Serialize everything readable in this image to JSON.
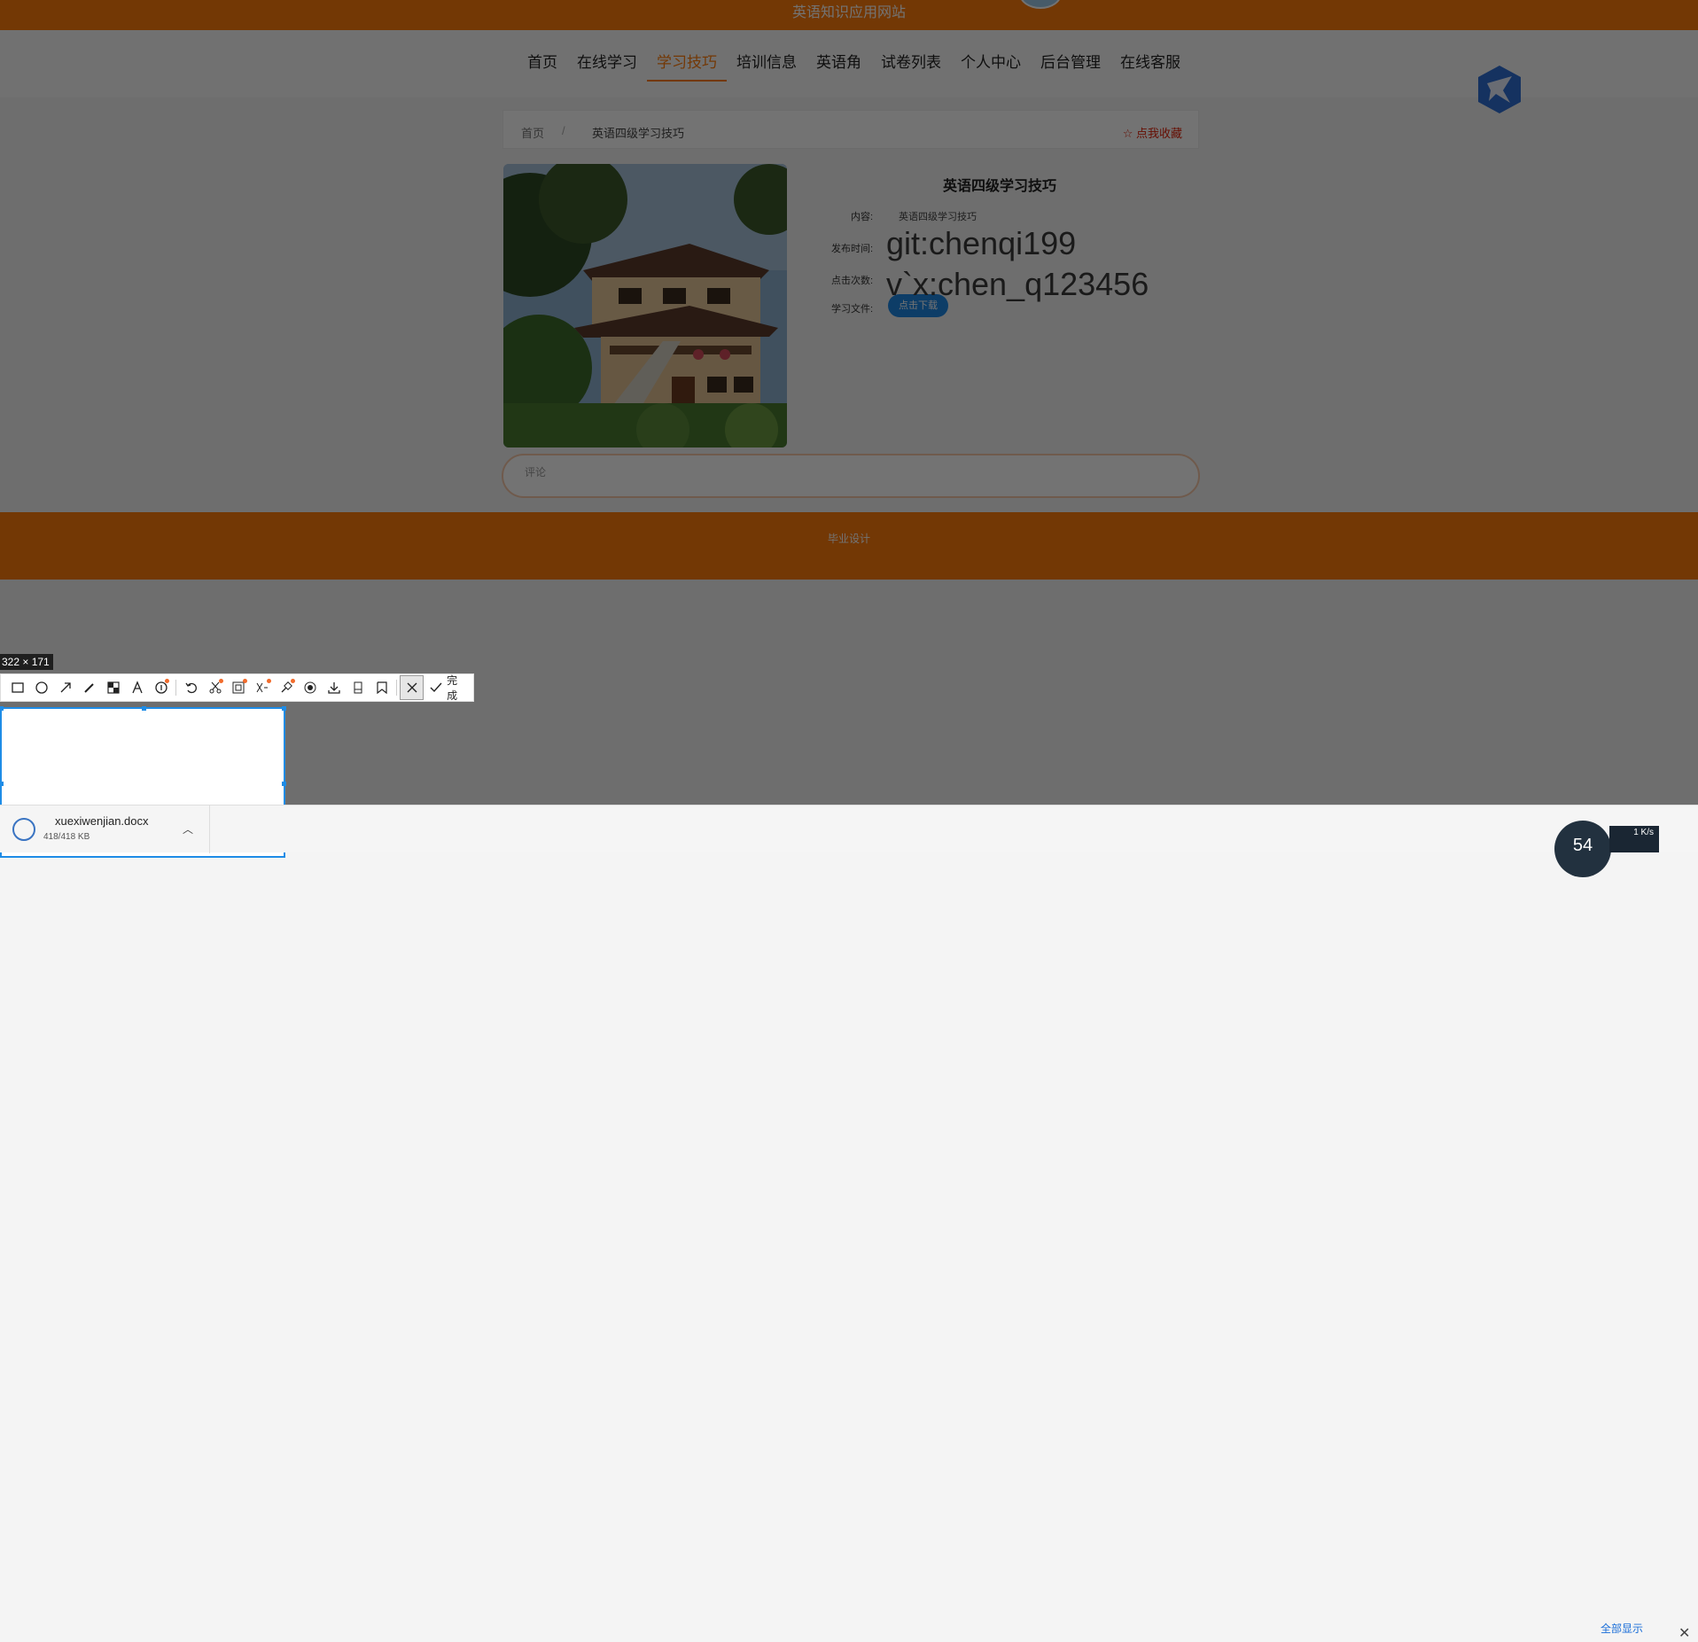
{
  "site": {
    "title": "英语知识应用网站"
  },
  "nav": {
    "items": [
      {
        "label": "首页"
      },
      {
        "label": "在线学习"
      },
      {
        "label": "学习技巧"
      },
      {
        "label": "培训信息"
      },
      {
        "label": "英语角"
      },
      {
        "label": "试卷列表"
      },
      {
        "label": "个人中心"
      },
      {
        "label": "后台管理"
      },
      {
        "label": "在线客服"
      }
    ],
    "active_index": 2
  },
  "breadcrumb": {
    "home": "首页",
    "sep": "/",
    "current": "英语四级学习技巧",
    "favorite": "☆ 点我收藏"
  },
  "detail": {
    "title": "英语四级学习技巧",
    "content_label": "内容:",
    "content_value": "英语四级学习技巧",
    "time_label": "发布时间:",
    "clicks_label": "点击次数:",
    "file_label": "学习文件:",
    "download_button": "点击下载"
  },
  "watermark": {
    "line1": "git:chenqi199",
    "line2": "v`x:chen_q123456"
  },
  "comment": {
    "placeholder": "评论"
  },
  "footer": {
    "text": "毕业设计"
  },
  "screenshot_tool": {
    "size_label": "322 × 171",
    "done_label": "完成",
    "tool_icons": [
      "rectangle-icon",
      "ellipse-icon",
      "arrow-icon",
      "pencil-icon",
      "mosaic-icon",
      "text-icon",
      "number-icon",
      "undo-icon",
      "scissors-icon",
      "ocr-icon",
      "translate-icon",
      "pin-icon",
      "record-icon",
      "download-icon",
      "long-screenshot-icon",
      "bookmark-icon",
      "cancel-icon",
      "confirm-icon"
    ]
  },
  "downloads": {
    "file_name": "xuexiwenjian.docx",
    "file_size": "418/418 KB",
    "show_all": "全部显示",
    "gauge": "54",
    "speed": "1 K/s"
  },
  "colors": {
    "brand_orange": "#ff7d0c",
    "link_blue": "#1e88e5",
    "selection_blue": "#1e8ce6"
  }
}
